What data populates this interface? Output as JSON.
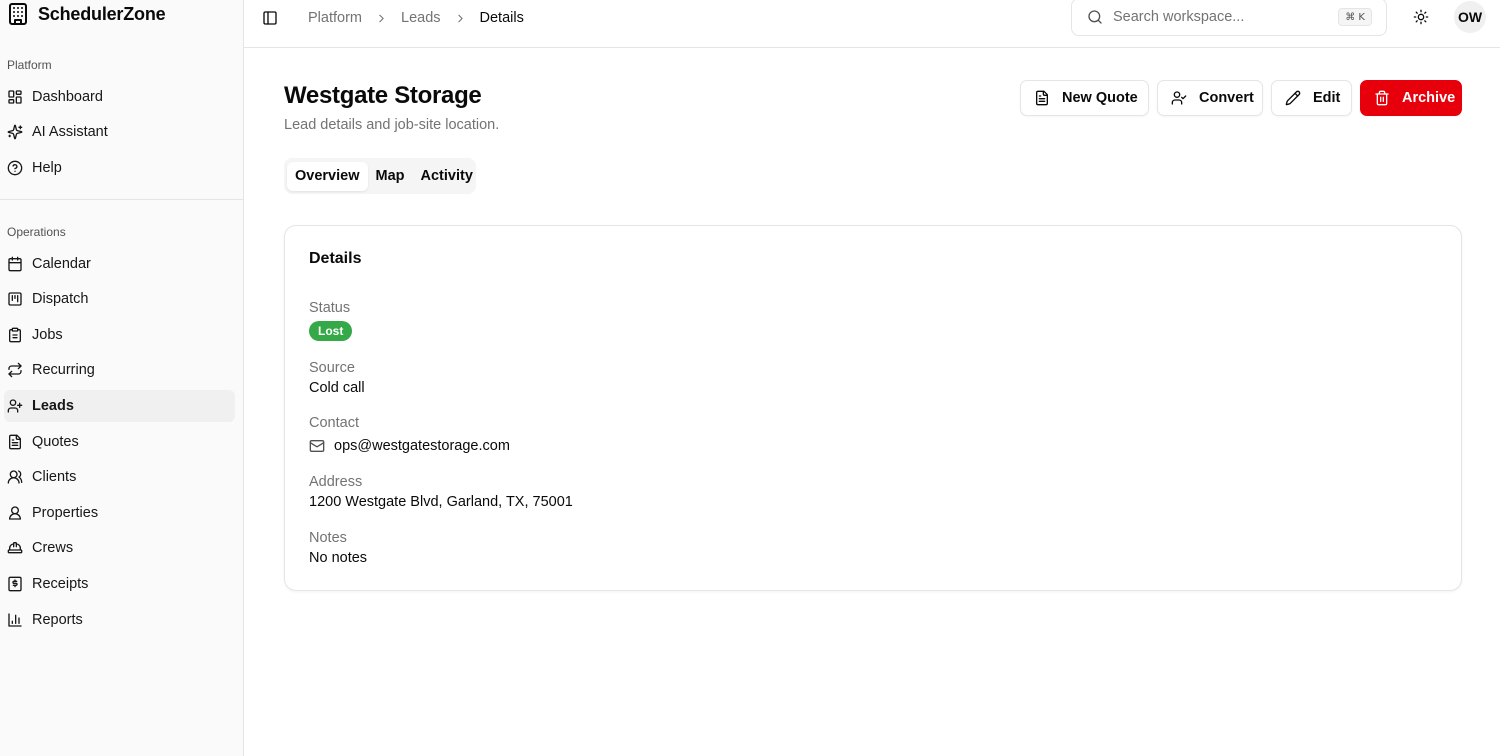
{
  "app": {
    "name": "SchedulerZone"
  },
  "sidebar": {
    "groups": [
      {
        "label": "Platform",
        "items": [
          {
            "label": "Dashboard",
            "icon": "layout-grid-icon"
          },
          {
            "label": "AI Assistant",
            "icon": "sparkles-icon"
          },
          {
            "label": "Help",
            "icon": "help-circle-icon"
          }
        ]
      },
      {
        "label": "Operations",
        "items": [
          {
            "label": "Calendar",
            "icon": "calendar-icon"
          },
          {
            "label": "Dispatch",
            "icon": "kanban-icon"
          },
          {
            "label": "Jobs",
            "icon": "clipboard-icon"
          },
          {
            "label": "Recurring",
            "icon": "repeat-icon"
          },
          {
            "label": "Leads",
            "icon": "user-plus-icon",
            "active": true
          },
          {
            "label": "Quotes",
            "icon": "file-text-icon"
          },
          {
            "label": "Clients",
            "icon": "users-icon"
          },
          {
            "label": "Properties",
            "icon": "user-pin-icon"
          },
          {
            "label": "Crews",
            "icon": "hard-hat-icon"
          },
          {
            "label": "Receipts",
            "icon": "receipt-icon"
          },
          {
            "label": "Reports",
            "icon": "bar-chart-icon"
          }
        ]
      }
    ]
  },
  "topbar": {
    "breadcrumb": [
      "Platform",
      "Leads",
      "Details"
    ],
    "search": {
      "placeholder": "Search workspace...",
      "shortcut": "⌘ K"
    },
    "avatar_initials": "OW"
  },
  "page": {
    "title": "Westgate Storage",
    "subtitle": "Lead details and job-site location.",
    "actions": {
      "new_quote": "New Quote",
      "convert": "Convert",
      "edit": "Edit",
      "archive": "Archive"
    },
    "tabs": [
      {
        "label": "Overview",
        "active": true
      },
      {
        "label": "Map"
      },
      {
        "label": "Activity"
      }
    ]
  },
  "details": {
    "title": "Details",
    "status_label": "Status",
    "status_value": "Lost",
    "source_label": "Source",
    "source_value": "Cold call",
    "contact_label": "Contact",
    "contact_email": "ops@westgatestorage.com",
    "address_label": "Address",
    "address_value": "1200 Westgate Blvd, Garland, TX, 75001",
    "notes_label": "Notes",
    "notes_value": "No notes"
  },
  "colors": {
    "archive_button": "#e7000b",
    "status_lost": "#35a847",
    "muted_text": "#737373",
    "border": "#e5e5e5"
  }
}
